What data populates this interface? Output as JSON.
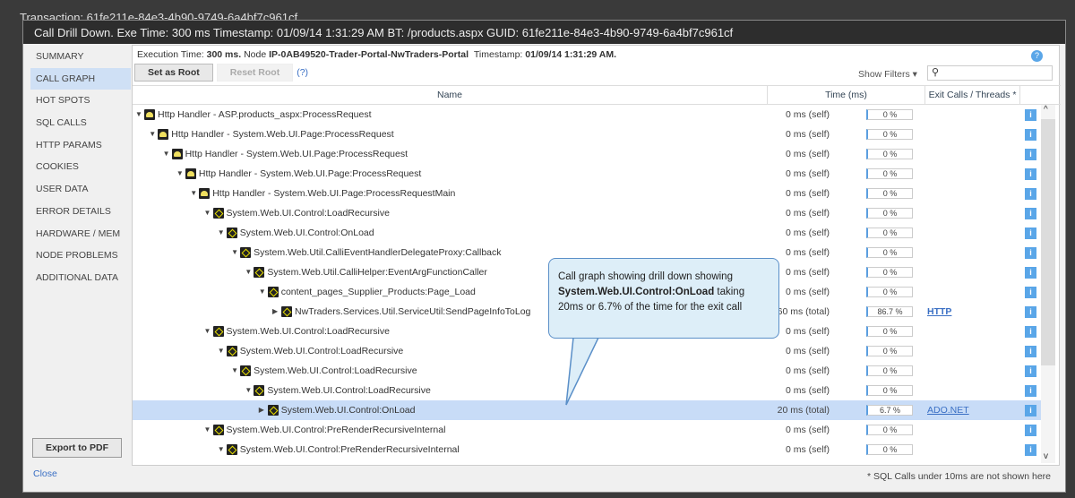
{
  "window": {
    "bg_title": "Transaction: 61fe211e-84e3-4b90-9749-6a4bf7c961cf",
    "title": "Call Drill Down.  Exe Time: 300 ms  Timestamp: 01/09/14 1:31:29 AM  BT: /products.aspx GUID: 61fe211e-84e3-4b90-9749-6a4bf7c961cf"
  },
  "sidebar": {
    "items": [
      "SUMMARY",
      "CALL GRAPH",
      "HOT SPOTS",
      "SQL CALLS",
      "HTTP PARAMS",
      "COOKIES",
      "USER DATA",
      "ERROR DETAILS",
      "HARDWARE / MEM",
      "NODE PROBLEMS",
      "ADDITIONAL DATA"
    ],
    "active": 1,
    "export_label": "Export to PDF",
    "close_label": "Close"
  },
  "info": {
    "exec_label": "Execution Time:",
    "exec_value": "300 ms.",
    "node_label": "Node",
    "node_value": "IP-0AB49520-Trader-Portal-NwTraders-Portal",
    "ts_label": "Timestamp:",
    "ts_value": "01/09/14 1:31:29 AM."
  },
  "toolbar": {
    "set_root": "Set as Root",
    "reset_root": "Reset Root",
    "help": "(?)",
    "show_filters": "Show Filters ▾",
    "search_placeholder": ""
  },
  "columns": {
    "name": "Name",
    "time": "Time (ms)",
    "exit": "Exit Calls / Threads *"
  },
  "rows": [
    {
      "level": 0,
      "icon": "handler",
      "expanded": true,
      "name": "Http Handler - ASP.products_aspx:ProcessRequest",
      "time": "0 ms (self)",
      "pct": 0,
      "pct_label": "0 %",
      "exit": ""
    },
    {
      "level": 1,
      "icon": "handler",
      "expanded": true,
      "name": "Http Handler - System.Web.UI.Page:ProcessRequest",
      "time": "0 ms (self)",
      "pct": 0,
      "pct_label": "0 %",
      "exit": ""
    },
    {
      "level": 2,
      "icon": "handler",
      "expanded": true,
      "name": "Http Handler - System.Web.UI.Page:ProcessRequest",
      "time": "0 ms (self)",
      "pct": 0,
      "pct_label": "0 %",
      "exit": ""
    },
    {
      "level": 3,
      "icon": "handler",
      "expanded": true,
      "name": "Http Handler - System.Web.UI.Page:ProcessRequest",
      "time": "0 ms (self)",
      "pct": 0,
      "pct_label": "0 %",
      "exit": ""
    },
    {
      "level": 4,
      "icon": "handler",
      "expanded": true,
      "name": "Http Handler - System.Web.UI.Page:ProcessRequestMain",
      "time": "0 ms (self)",
      "pct": 0,
      "pct_label": "0 %",
      "exit": ""
    },
    {
      "level": 5,
      "icon": "code",
      "expanded": true,
      "name": "System.Web.UI.Control:LoadRecursive",
      "time": "0 ms (self)",
      "pct": 0,
      "pct_label": "0 %",
      "exit": ""
    },
    {
      "level": 6,
      "icon": "code",
      "expanded": true,
      "name": "System.Web.UI.Control:OnLoad",
      "time": "0 ms (self)",
      "pct": 0,
      "pct_label": "0 %",
      "exit": ""
    },
    {
      "level": 7,
      "icon": "code",
      "expanded": true,
      "name": "System.Web.Util.CalliEventHandlerDelegateProxy:Callback",
      "time": "0 ms (self)",
      "pct": 0,
      "pct_label": "0 %",
      "exit": ""
    },
    {
      "level": 8,
      "icon": "code",
      "expanded": true,
      "name": "System.Web.Util.CalliHelper:EventArgFunctionCaller",
      "time": "0 ms (self)",
      "pct": 0,
      "pct_label": "0 %",
      "exit": ""
    },
    {
      "level": 9,
      "icon": "code",
      "expanded": true,
      "name": "content_pages_Supplier_Products:Page_Load",
      "time": "0 ms (self)",
      "pct": 0,
      "pct_label": "0 %",
      "exit": ""
    },
    {
      "level": 10,
      "icon": "code",
      "expanded": false,
      "name": "NwTraders.Services.Util.ServiceUtil:SendPageInfoToLog",
      "time": "260 ms (total)",
      "pct": 86.7,
      "pct_label": "86.7 %",
      "exit": "HTTP"
    },
    {
      "level": 5,
      "icon": "code",
      "expanded": true,
      "name": "System.Web.UI.Control:LoadRecursive",
      "time": "0 ms (self)",
      "pct": 0,
      "pct_label": "0 %",
      "exit": ""
    },
    {
      "level": 6,
      "icon": "code",
      "expanded": true,
      "name": "System.Web.UI.Control:LoadRecursive",
      "time": "0 ms (self)",
      "pct": 0,
      "pct_label": "0 %",
      "exit": ""
    },
    {
      "level": 7,
      "icon": "code",
      "expanded": true,
      "name": "System.Web.UI.Control:LoadRecursive",
      "time": "0 ms (self)",
      "pct": 0,
      "pct_label": "0 %",
      "exit": ""
    },
    {
      "level": 8,
      "icon": "code",
      "expanded": true,
      "name": "System.Web.UI.Control:LoadRecursive",
      "time": "0 ms (self)",
      "pct": 0,
      "pct_label": "0 %",
      "exit": ""
    },
    {
      "level": 9,
      "icon": "code",
      "expanded": false,
      "selected": true,
      "name": "System.Web.UI.Control:OnLoad",
      "time": "20 ms (total)",
      "pct": 6.7,
      "pct_label": "6.7 %",
      "exit": "ADO.NET"
    },
    {
      "level": 5,
      "icon": "code",
      "expanded": true,
      "name": "System.Web.UI.Control:PreRenderRecursiveInternal",
      "time": "0 ms (self)",
      "pct": 0,
      "pct_label": "0 %",
      "exit": ""
    },
    {
      "level": 6,
      "icon": "code",
      "expanded": true,
      "name": "System.Web.UI.Control:PreRenderRecursiveInternal",
      "time": "0 ms (self)",
      "pct": 0,
      "pct_label": "0 %",
      "exit": ""
    }
  ],
  "footnote": "* SQL Calls under 10ms are not shown here",
  "callout": {
    "line1": "Call graph showing drill down showing",
    "bold": "System.Web.UI.Control:OnLoad",
    "line2": " taking 20ms or 6.7% of the time for the exit call"
  },
  "colors": {
    "accent": "#5aa6e8",
    "bar": "#f39424",
    "selected": "#c8dcf7"
  }
}
